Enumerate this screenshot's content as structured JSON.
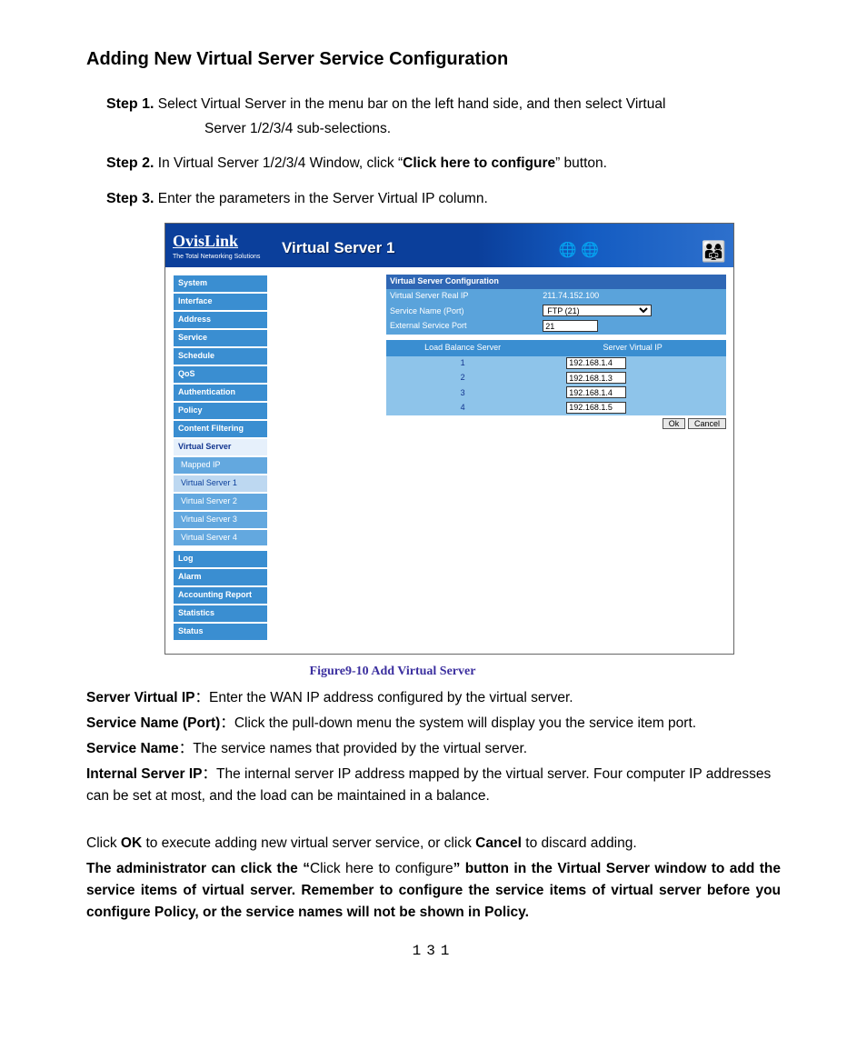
{
  "title": "Adding New Virtual Server Service Configuration",
  "steps": {
    "s1": {
      "label": "Step 1.",
      "text_a": "Select Virtual Server in the menu bar on the left hand side, and then select Virtual",
      "text_b": "Server 1/2/3/4 sub-selections."
    },
    "s2": {
      "label": "Step 2.",
      "pre": "In Virtual Server 1/2/3/4 Window, click “",
      "bold": "Click here to configure",
      "post": "” button."
    },
    "s3": {
      "label": "Step 3.",
      "text": "Enter the parameters in the Server Virtual IP column."
    }
  },
  "banner": {
    "brand": "OvisLink",
    "tagline": "The Total Networking Solutions",
    "title": "Virtual Server 1"
  },
  "nav": {
    "group1": [
      "System",
      "Interface",
      "Address",
      "Service",
      "Schedule",
      "QoS",
      "Authentication",
      "Policy",
      "Content Filtering"
    ],
    "vs_label": "Virtual Server",
    "vs_sub": [
      "Mapped IP",
      "Virtual Server 1",
      "Virtual Server 2",
      "Virtual Server 3",
      "Virtual Server 4"
    ],
    "group3": [
      "Log",
      "Alarm",
      "Accounting Report",
      "Statistics",
      "Status"
    ]
  },
  "conf": {
    "header": "Virtual Server Configuration",
    "real_ip_label": "Virtual Server Real IP",
    "real_ip_value": "211.74.152.100",
    "service_label": "Service Name (Port)",
    "service_value": "FTP (21)",
    "ext_port_label": "External Service Port",
    "ext_port_value": "21",
    "lb_header": "Load Balance Server",
    "vip_header": "Server Virtual IP",
    "rows": [
      {
        "n": "1",
        "ip": "192.168.1.4"
      },
      {
        "n": "2",
        "ip": "192.168.1.3"
      },
      {
        "n": "3",
        "ip": "192.168.1.4"
      },
      {
        "n": "4",
        "ip": "192.168.1.5"
      }
    ],
    "ok": "Ok",
    "cancel": "Cancel"
  },
  "caption": "Figure9-10 Add Virtual Server",
  "defs": {
    "svip_l": "Server Virtual IP",
    "svip_t": "：Enter the WAN IP address configured by the virtual server.",
    "snp_l": "Service Name (Port)",
    "snp_t": "：Click the pull-down menu the system will display you the service item port.",
    "sn_l": "Service Name",
    "sn_t": "：The service names that provided by the virtual server.",
    "isip_l": "Internal Server IP",
    "isip_t": "：The internal server IP address mapped by the virtual server. Four computer IP addresses can be set at most, and the load can be maintained in a balance."
  },
  "closing": {
    "p1_a": "Click ",
    "p1_b": "OK",
    "p1_c": " to execute adding new virtual server service, or click ",
    "p1_d": "Cancel",
    "p1_e": " to discard adding.",
    "p2_a": "The administrator can click the “",
    "p2_b": "Click here to configure",
    "p2_c": "” button in the Virtual Server window to add the service items of virtual server. Remember to configure the service items of virtual server before you configure Policy, or the service names will not be shown in Policy."
  },
  "pagenum": "131"
}
